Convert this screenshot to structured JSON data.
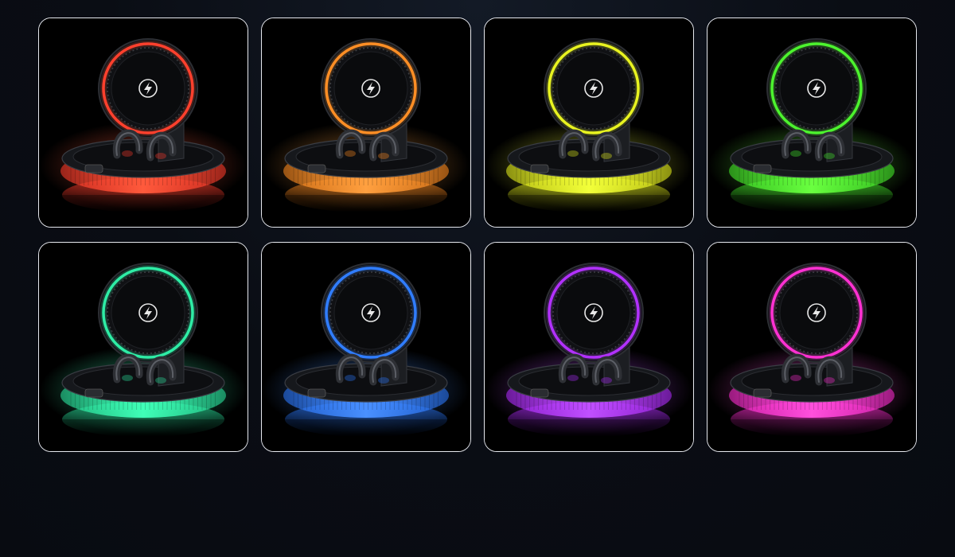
{
  "gallery": {
    "tiles": [
      {
        "color_name": "red",
        "accent": "#ff3a2a",
        "glow": "#ff5a3c"
      },
      {
        "color_name": "orange",
        "accent": "#ff8a1e",
        "glow": "#ffa040"
      },
      {
        "color_name": "yellow",
        "accent": "#e6f01a",
        "glow": "#f2ff3a"
      },
      {
        "color_name": "green",
        "accent": "#45f02a",
        "glow": "#6aff40"
      },
      {
        "color_name": "mint",
        "accent": "#2ae8a0",
        "glow": "#40ffb8"
      },
      {
        "color_name": "blue",
        "accent": "#2a78ff",
        "glow": "#4a90ff"
      },
      {
        "color_name": "purple",
        "accent": "#b02aff",
        "glow": "#c050ff"
      },
      {
        "color_name": "pink",
        "accent": "#ff2ad0",
        "glow": "#ff50dc"
      }
    ],
    "charger_icon": "lightning-bolt-icon",
    "border_color": "#e6e8ee",
    "background_color": "#0a0d14"
  }
}
